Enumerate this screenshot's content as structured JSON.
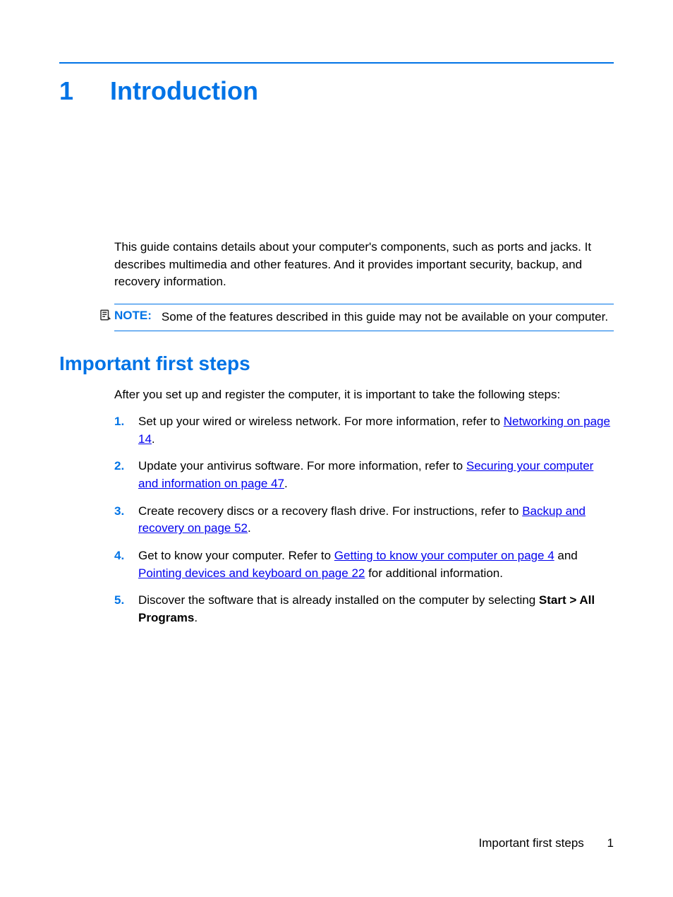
{
  "chapter": {
    "number": "1",
    "title": "Introduction"
  },
  "intro": "This guide contains details about your computer's components, such as ports and jacks. It describes multimedia and other features. And it provides important security, backup, and recovery information.",
  "note": {
    "label": "NOTE:",
    "text": "Some of the features described in this guide may not be available on your computer."
  },
  "section": {
    "title": "Important first steps",
    "after": "After you set up and register the computer, it is important to take the following steps:"
  },
  "steps": {
    "s1": {
      "num": "1.",
      "pre": "Set up your wired or wireless network. For more information, refer to ",
      "link1": "Networking on page 14",
      "post1": "."
    },
    "s2": {
      "num": "2.",
      "pre": "Update your antivirus software. For more information, refer to ",
      "link1": "Securing your computer and information on page 47",
      "post1": "."
    },
    "s3": {
      "num": "3.",
      "pre": "Create recovery discs or a recovery flash drive. For instructions, refer to ",
      "link1": "Backup and recovery on page 52",
      "post1": "."
    },
    "s4": {
      "num": "4.",
      "pre": "Get to know your computer. Refer to ",
      "link1": "Getting to know your computer on page 4",
      "mid": " and ",
      "link2": "Pointing devices and keyboard on page 22",
      "post2": " for additional information."
    },
    "s5": {
      "num": "5.",
      "pre": "Discover the software that is already installed on the computer by selecting ",
      "bold": "Start > All Programs",
      "post": "."
    }
  },
  "footer": {
    "text": "Important first steps",
    "page": "1"
  }
}
